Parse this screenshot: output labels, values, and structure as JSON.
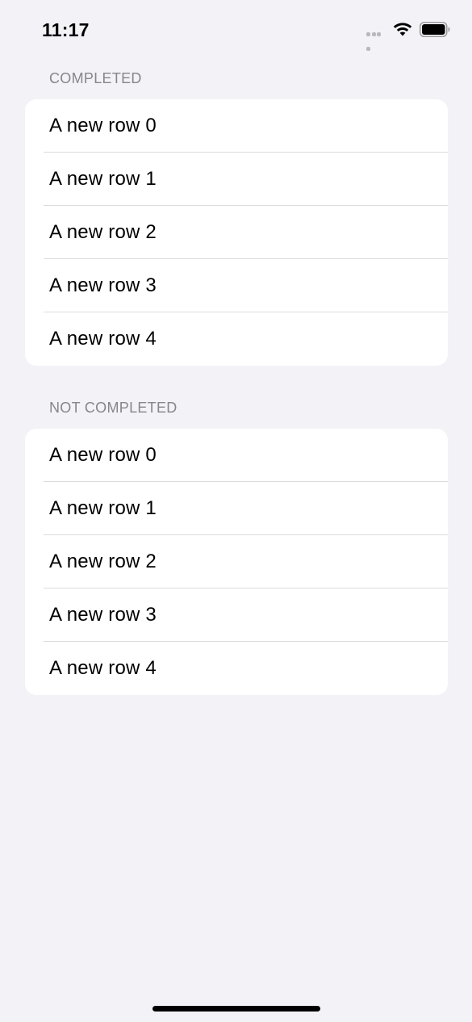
{
  "status_bar": {
    "time": "11:17",
    "signal_icon": "cellular-dots-icon",
    "wifi_icon": "wifi-icon",
    "battery_icon": "battery-icon"
  },
  "sections": [
    {
      "header": "COMPLETED",
      "rows": [
        {
          "label": "A new row 0"
        },
        {
          "label": "A new row 1"
        },
        {
          "label": "A new row 2"
        },
        {
          "label": "A new row 3"
        },
        {
          "label": "A new row 4"
        }
      ]
    },
    {
      "header": "NOT COMPLETED",
      "rows": [
        {
          "label": "A new row 0"
        },
        {
          "label": "A new row 1"
        },
        {
          "label": "A new row 2"
        },
        {
          "label": "A new row 3"
        },
        {
          "label": "A new row 4"
        }
      ]
    }
  ],
  "colors": {
    "background": "#f2f2f7",
    "card": "#ffffff",
    "header_text": "#86868b",
    "separator": "#dcdce0"
  }
}
